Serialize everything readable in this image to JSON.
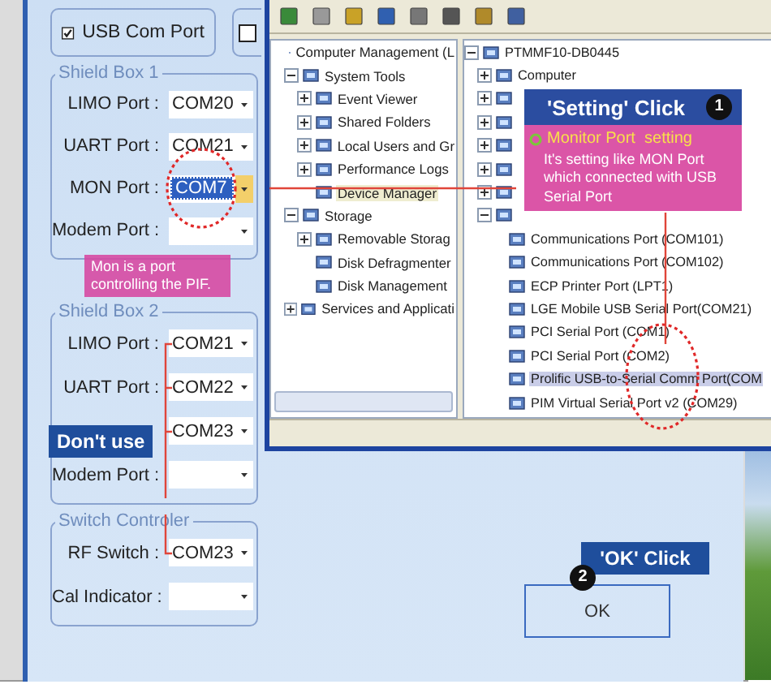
{
  "dialog": {
    "checkboxes": [
      {
        "label": "USB Com Port",
        "checked": true
      },
      {
        "checked": false
      }
    ],
    "groups": [
      {
        "title": "Shield Box 1",
        "fields": [
          {
            "label": "LIMO Port :",
            "value": "COM20",
            "selected": false
          },
          {
            "label": "UART Port :",
            "value": "COM21",
            "selected": false
          },
          {
            "label": "MON Port :",
            "value": "COM7",
            "selected": true
          },
          {
            "label": "Modem Port :",
            "selected": false
          }
        ]
      },
      {
        "title": "Shield Box 2",
        "fields": [
          {
            "label": "LIMO Port :",
            "value": "COM21",
            "selected": false
          },
          {
            "label": "UART Port :",
            "value": "COM22",
            "selected": false
          },
          {
            "value": "COM23",
            "selected": false
          },
          {
            "label": "Modem Port :",
            "selected": false
          }
        ]
      },
      {
        "title": "Switch Controler",
        "fields": [
          {
            "label": "RF Switch :",
            "value": "COM23",
            "selected": false
          },
          {
            "label": "Cal Indicator :",
            "selected": false
          }
        ]
      }
    ],
    "ok_button": "OK"
  },
  "window": {
    "left_tree": [
      {
        "label": "Computer Management (L",
        "selected": false,
        "children": [
          {
            "label": "System Tools",
            "expanded": true,
            "selected": false,
            "children": [
              {
                "label": "Event Viewer",
                "expanded": false,
                "selected": false
              },
              {
                "label": "Shared Folders",
                "expanded": false,
                "selected": false
              },
              {
                "label": "Local Users and Gr",
                "expanded": false,
                "selected": false
              },
              {
                "label": "Performance Logs",
                "expanded": false,
                "selected": false
              },
              {
                "label": "Device Manager",
                "selected": true
              }
            ]
          },
          {
            "label": "Storage",
            "expanded": true,
            "selected": false,
            "children": [
              {
                "label": "Removable Storag",
                "expanded": false,
                "selected": false
              },
              {
                "label": "Disk Defragmenter",
                "selected": false
              },
              {
                "label": "Disk Management",
                "selected": false
              }
            ]
          },
          {
            "label": "Services and Applicati",
            "expanded": false,
            "selected": false
          }
        ]
      }
    ],
    "right_tree": [
      {
        "label": "PTMMF10-DB0445",
        "expanded": true,
        "selected": false,
        "children": [
          {
            "label": "Computer",
            "expanded": false,
            "selected": false
          },
          {
            "expanded": false
          },
          {
            "expanded": false
          },
          {
            "expanded": false
          },
          {
            "expanded": false
          },
          {
            "expanded": false
          },
          {
            "expanded": true,
            "children": [
              {
                "label": "Communications Port (COM101)",
                "selected": false
              },
              {
                "label": "Communications Port (COM102)",
                "selected": false
              },
              {
                "label": "ECP Printer Port (LPT1)",
                "selected": false
              },
              {
                "label": "LGE Mobile USB Serial Port(COM21)",
                "selected": false
              },
              {
                "label": "PCI Serial Port (COM1)",
                "selected": false
              },
              {
                "label": "PCI Serial Port (COM2)",
                "selected": false
              },
              {
                "label": "Prolific USB-to-Serial Comm Port(COM",
                "selected": true
              },
              {
                "label": "PIM Virtual Serial Port v2 (COM29)",
                "selected": false
              }
            ]
          }
        ]
      }
    ]
  },
  "callouts": {
    "note": "Mon is a port controlling the PIF.",
    "dont_use": "Don't use",
    "setting": {
      "title": "'Setting' Click",
      "badge": "1",
      "heading": "Monitor Port  setting",
      "text": "It's setting like MON Port which connected with USB Serial Port"
    },
    "ok": {
      "title": "'OK' Click",
      "badge": "2"
    }
  }
}
